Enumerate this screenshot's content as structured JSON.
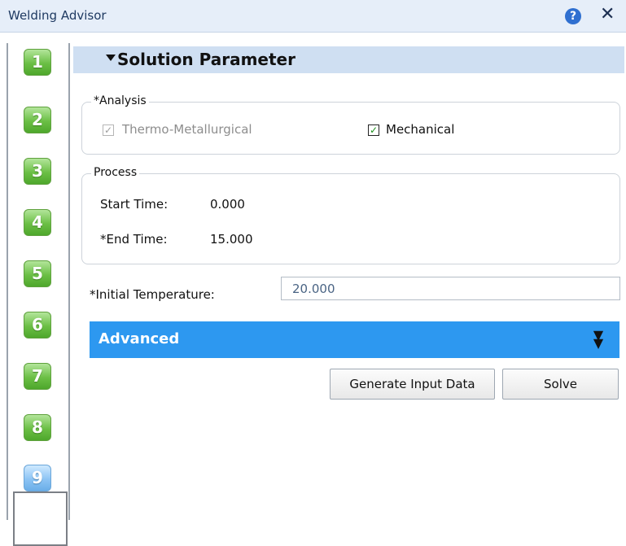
{
  "window": {
    "title": "Welding Advisor",
    "help_icon": "help-icon",
    "close_icon": "close-icon",
    "close_glyph": "✕",
    "help_glyph": "?"
  },
  "steps": [
    "1",
    "2",
    "3",
    "4",
    "5",
    "6",
    "7",
    "8",
    "9"
  ],
  "active_step": "9",
  "section": {
    "title": "Solution Parameter"
  },
  "analysis": {
    "legend": "*Analysis",
    "thermo_label": "Thermo-Metallurgical",
    "thermo_checked": true,
    "thermo_disabled": true,
    "mechanical_label": "Mechanical",
    "mechanical_checked": true
  },
  "process": {
    "legend": "Process",
    "start_label": "Start Time:",
    "start_value": "0.000",
    "end_label": "*End Time:",
    "end_value": "15.000"
  },
  "initial_temperature": {
    "label": "*Initial Temperature:",
    "value": "20.000"
  },
  "advanced": {
    "label": "Advanced"
  },
  "buttons": {
    "generate": "Generate Input Data",
    "solve": "Solve"
  },
  "colors": {
    "accent": "#2d98f0",
    "header_bg": "#cfdff2",
    "step_green": "#6bbf45",
    "step_active_blue": "#8cc4f4"
  }
}
